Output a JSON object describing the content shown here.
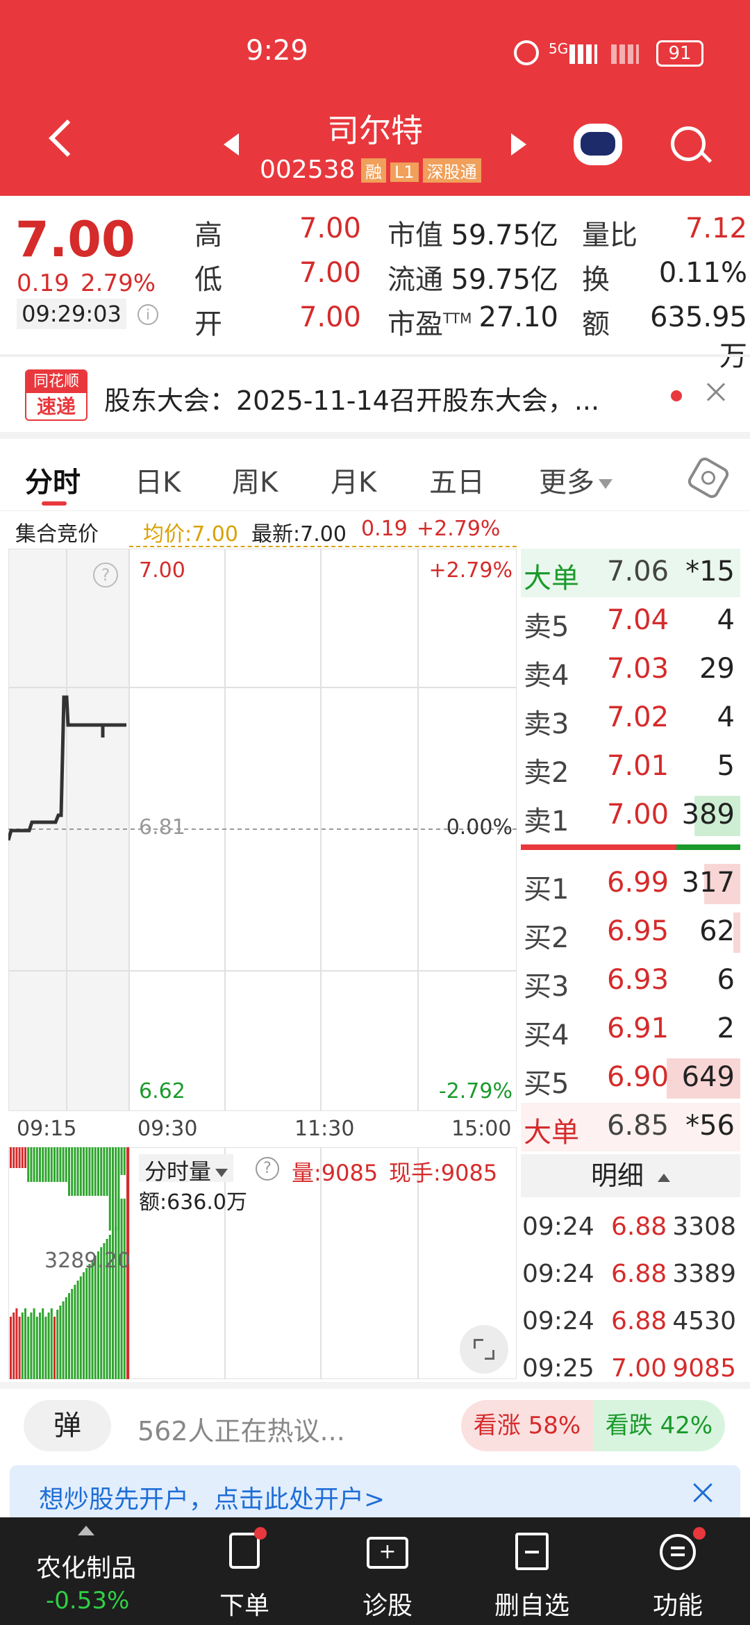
{
  "status": {
    "time": "9:29",
    "net": "5G",
    "battery": "91"
  },
  "header": {
    "name": "司尔特",
    "code": "002538",
    "tags": [
      "融",
      "L1",
      "深股通"
    ]
  },
  "quote": {
    "price": "7.00",
    "change": "0.19",
    "pct": "2.79%",
    "time": "09:29:03",
    "rows": [
      {
        "l1": "高",
        "v1": "7.00",
        "l2": "市值",
        "v2": "59.75亿",
        "l3": "量比",
        "v3": "7.12"
      },
      {
        "l1": "低",
        "v1": "7.00",
        "l2": "流通",
        "v2": "59.75亿",
        "l3": "换",
        "v3": "0.11%"
      },
      {
        "l1": "开",
        "v1": "7.00",
        "l2": "市盈",
        "l2sup": "TTM",
        "v2": "27.10",
        "l3": "额",
        "v3": "635.95万"
      }
    ]
  },
  "news": {
    "badge_top": "同花顺",
    "badge_bottom": "速递",
    "text": "股东大会：2025-11-14召开股东大会，..."
  },
  "tabs": [
    "分时",
    "日K",
    "周K",
    "月K",
    "五日",
    "更多"
  ],
  "infobar": {
    "label": "集合竞价",
    "avg": "均价:7.00",
    "latest": "最新:7.00",
    "chg": "0.19",
    "pct": "+2.79%"
  },
  "chart": {
    "y_top": "7.00",
    "y_mid": "6.81",
    "y_bot": "6.62",
    "p_top": "+2.79%",
    "p_mid": "0.00%",
    "p_bot": "-2.79%",
    "x": [
      "09:15",
      "09:30",
      "11:30",
      "15:00"
    ],
    "vol_label": "3289.20",
    "vol_title": "分时量",
    "vol": "量:9085",
    "now": "现手:9085",
    "amt": "额:636.0万",
    "vol_right": "9085.00"
  },
  "orderbook": {
    "big_top": {
      "label": "大单",
      "price": "7.06",
      "qty": "*15"
    },
    "sells": [
      {
        "l": "卖5",
        "p": "7.04",
        "q": "4"
      },
      {
        "l": "卖4",
        "p": "7.03",
        "q": "29"
      },
      {
        "l": "卖3",
        "p": "7.02",
        "q": "4"
      },
      {
        "l": "卖2",
        "p": "7.01",
        "q": "5"
      },
      {
        "l": "卖1",
        "p": "7.00",
        "q": "389"
      }
    ],
    "buys": [
      {
        "l": "买1",
        "p": "6.99",
        "q": "317"
      },
      {
        "l": "买2",
        "p": "6.95",
        "q": "62"
      },
      {
        "l": "买3",
        "p": "6.93",
        "q": "6"
      },
      {
        "l": "买4",
        "p": "6.91",
        "q": "2"
      },
      {
        "l": "买5",
        "p": "6.90",
        "q": "649"
      }
    ],
    "big_bot": {
      "label": "大单",
      "price": "6.85",
      "qty": "*56"
    },
    "detail_title": "明细",
    "trades": [
      {
        "t": "09:24",
        "p": "6.88",
        "v": "3308"
      },
      {
        "t": "09:24",
        "p": "6.88",
        "v": "3389"
      },
      {
        "t": "09:24",
        "p": "6.88",
        "v": "4530"
      },
      {
        "t": "09:25",
        "p": "7.00",
        "v": "9085"
      }
    ]
  },
  "discuss": {
    "danmu": "弹",
    "text": "562人正在热议...",
    "up": "看涨 58%",
    "down": "看跌 42%"
  },
  "banner": {
    "text": "想炒股先开户，点击此处开户>"
  },
  "bottom": {
    "sector": "农化制品",
    "sector_pct": "-0.53%",
    "items": [
      "下单",
      "诊股",
      "删自选",
      "功能"
    ]
  },
  "colors": {
    "brand": "#e8383d",
    "up": "#d52b2b",
    "down": "#1a9a2a"
  }
}
